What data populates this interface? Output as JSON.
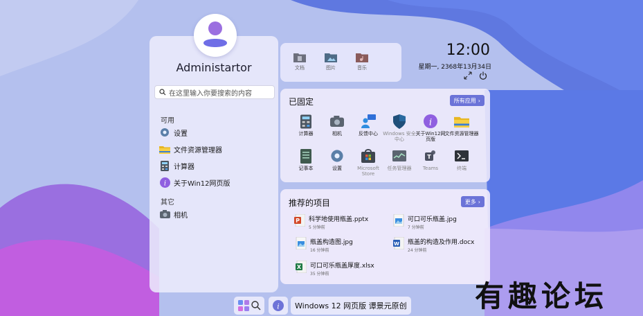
{
  "user": {
    "name": "Administartor"
  },
  "search": {
    "placeholder": "在这里输入你要搜索的内容"
  },
  "sections": {
    "available": "可用",
    "other": "其它"
  },
  "left_apps": [
    {
      "label": "设置",
      "icon": "gear-icon"
    },
    {
      "label": "文件资源管理器",
      "icon": "folder-icon"
    },
    {
      "label": "计算器",
      "icon": "calculator-icon"
    },
    {
      "label": "关于Win12网页版",
      "icon": "info-icon"
    }
  ],
  "other_apps": [
    {
      "label": "相机",
      "icon": "camera-icon"
    }
  ],
  "quick_links": [
    {
      "label": "文档",
      "icon": "document-folder-icon"
    },
    {
      "label": "图片",
      "icon": "picture-folder-icon"
    },
    {
      "label": "音乐",
      "icon": "music-folder-icon"
    }
  ],
  "clock": {
    "time": "12:00",
    "date": "星期一, 2368年13月34日"
  },
  "pinned": {
    "title": "已固定",
    "all_apps_label": "所有应用",
    "apps": [
      {
        "label": "计算器",
        "icon": "calculator-icon",
        "dim": false
      },
      {
        "label": "相机",
        "icon": "camera-icon",
        "dim": false
      },
      {
        "label": "反馈中心",
        "icon": "feedback-icon",
        "dim": false
      },
      {
        "label": "Windows 安全中心",
        "icon": "shield-icon",
        "dim": true
      },
      {
        "label": "关于Win12网页版",
        "icon": "info-icon",
        "dim": false
      },
      {
        "label": "文件资源管理器",
        "icon": "folder-icon",
        "dim": false
      },
      {
        "label": "记事本",
        "icon": "notepad-icon",
        "dim": false
      },
      {
        "label": "设置",
        "icon": "gear-icon",
        "dim": false
      },
      {
        "label": "Microsoft Store",
        "icon": "store-icon",
        "dim": true
      },
      {
        "label": "任务管理器",
        "icon": "task-manager-icon",
        "dim": true
      },
      {
        "label": "Teams",
        "icon": "teams-icon",
        "dim": true
      },
      {
        "label": "终端",
        "icon": "terminal-icon",
        "dim": true
      }
    ]
  },
  "recommended": {
    "title": "推荐的项目",
    "more_label": "更多",
    "items": [
      {
        "name": "科学地使用瓶盖.pptx",
        "time": "5 分钟前",
        "icon": "powerpoint-file-icon"
      },
      {
        "name": "可口可乐瓶盖.jpg",
        "time": "7 分钟前",
        "icon": "image-file-icon"
      },
      {
        "name": "瓶盖构造图.jpg",
        "time": "16 分钟前",
        "icon": "image-file-icon"
      },
      {
        "name": "瓶盖的构造及作用.docx",
        "time": "24 分钟前",
        "icon": "word-file-icon"
      },
      {
        "name": "可口可乐瓶盖厚度.xlsx",
        "time": "35 分钟前",
        "icon": "excel-file-icon"
      }
    ]
  },
  "taskbar": {
    "title": "Windows 12 网页版 谭景元原创"
  },
  "watermark": "有趣论坛",
  "colors": {
    "accent": "#6b73d8",
    "panel": "#ececfc"
  }
}
